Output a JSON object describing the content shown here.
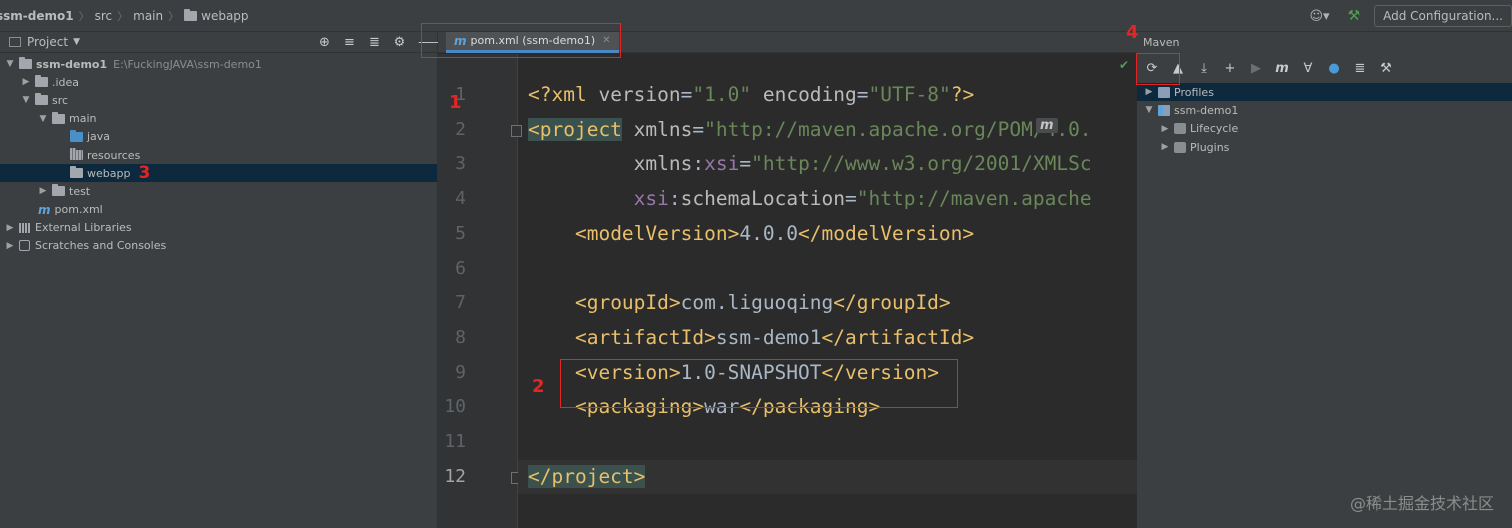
{
  "breadcrumb": {
    "project": "ssm-demo1",
    "src": "src",
    "main": "main",
    "webapp": "webapp"
  },
  "navbar": {
    "run_config": "Add Configuration..."
  },
  "project_panel": {
    "title": "Project",
    "tree": [
      {
        "label": "ssm-demo1",
        "path": "E:\\FuckingJAVA\\ssm-demo1"
      },
      {
        "label": ".idea"
      },
      {
        "label": "src"
      },
      {
        "label": "main"
      },
      {
        "label": "java"
      },
      {
        "label": "resources"
      },
      {
        "label": "webapp"
      },
      {
        "label": "test"
      },
      {
        "label": "pom.xml"
      },
      {
        "label": "External Libraries"
      },
      {
        "label": "Scratches and Consoles"
      }
    ]
  },
  "editor": {
    "tab_label": "pom.xml (ssm-demo1)",
    "current_line": 12,
    "lines": [
      {
        "n": "1",
        "parts": [
          {
            "c": "tag",
            "t": "<?xml "
          },
          {
            "c": "attr",
            "t": "version"
          },
          {
            "c": "txt",
            "t": "="
          },
          {
            "c": "str",
            "t": "\"1.0\" "
          },
          {
            "c": "attr",
            "t": "encoding"
          },
          {
            "c": "txt",
            "t": "="
          },
          {
            "c": "str",
            "t": "\"UTF-8\""
          },
          {
            "c": "tag",
            "t": "?>"
          }
        ]
      },
      {
        "n": "2",
        "parts": [
          {
            "c": "tag hl-tag",
            "t": "<project"
          },
          {
            "c": "txt",
            "t": " "
          },
          {
            "c": "attr",
            "t": "xmlns"
          },
          {
            "c": "txt",
            "t": "="
          },
          {
            "c": "str",
            "t": "\"http://maven.apache.org/POM/4.0."
          }
        ]
      },
      {
        "n": "3",
        "parts": [
          {
            "c": "txt",
            "t": "         "
          },
          {
            "c": "attr",
            "t": "xmlns"
          },
          {
            "c": "txt",
            "t": ":"
          },
          {
            "c": "ns",
            "t": "xsi"
          },
          {
            "c": "txt",
            "t": "="
          },
          {
            "c": "str",
            "t": "\"http://www.w3.org/2001/XMLSc"
          }
        ]
      },
      {
        "n": "4",
        "parts": [
          {
            "c": "txt",
            "t": "         "
          },
          {
            "c": "ns",
            "t": "xsi"
          },
          {
            "c": "txt",
            "t": ":"
          },
          {
            "c": "attr",
            "t": "schemaLocation"
          },
          {
            "c": "txt",
            "t": "="
          },
          {
            "c": "str",
            "t": "\"http://maven.apache"
          }
        ]
      },
      {
        "n": "5",
        "parts": [
          {
            "c": "txt",
            "t": "    "
          },
          {
            "c": "tag",
            "t": "<modelVersion>"
          },
          {
            "c": "txt",
            "t": "4.0.0"
          },
          {
            "c": "tag",
            "t": "</modelVersion>"
          }
        ]
      },
      {
        "n": "6",
        "parts": []
      },
      {
        "n": "7",
        "parts": [
          {
            "c": "txt",
            "t": "    "
          },
          {
            "c": "tag",
            "t": "<groupId>"
          },
          {
            "c": "txt",
            "t": "com.liguoqing"
          },
          {
            "c": "tag",
            "t": "</groupId>"
          }
        ]
      },
      {
        "n": "8",
        "parts": [
          {
            "c": "txt",
            "t": "    "
          },
          {
            "c": "tag",
            "t": "<artifactId>"
          },
          {
            "c": "txt",
            "t": "ssm-demo1"
          },
          {
            "c": "tag",
            "t": "</artifactId>"
          }
        ]
      },
      {
        "n": "9",
        "parts": [
          {
            "c": "txt",
            "t": "    "
          },
          {
            "c": "tag",
            "t": "<version>"
          },
          {
            "c": "txt",
            "t": "1.0-SNAPSHOT"
          },
          {
            "c": "tag",
            "t": "</version>"
          }
        ]
      },
      {
        "n": "10",
        "parts": [
          {
            "c": "txt",
            "t": "    "
          },
          {
            "c": "tag",
            "t": "<packaging>"
          },
          {
            "c": "txt",
            "t": "war"
          },
          {
            "c": "tag",
            "t": "</packaging>"
          }
        ]
      },
      {
        "n": "11",
        "parts": []
      },
      {
        "n": "12",
        "parts": [
          {
            "c": "tag hl-tag",
            "t": "</project>"
          }
        ]
      }
    ]
  },
  "maven_panel": {
    "title": "Maven",
    "tree": [
      {
        "label": "Profiles"
      },
      {
        "label": "ssm-demo1"
      },
      {
        "label": "Lifecycle"
      },
      {
        "label": "Plugins"
      }
    ]
  },
  "annotations": {
    "n1": "1",
    "n2": "2",
    "n3": "3",
    "n4": "4"
  },
  "watermark": "@稀土掘金技术社区",
  "icons": {
    "accent_blue": "#4a88c7",
    "annotation_red": "#e52525"
  }
}
